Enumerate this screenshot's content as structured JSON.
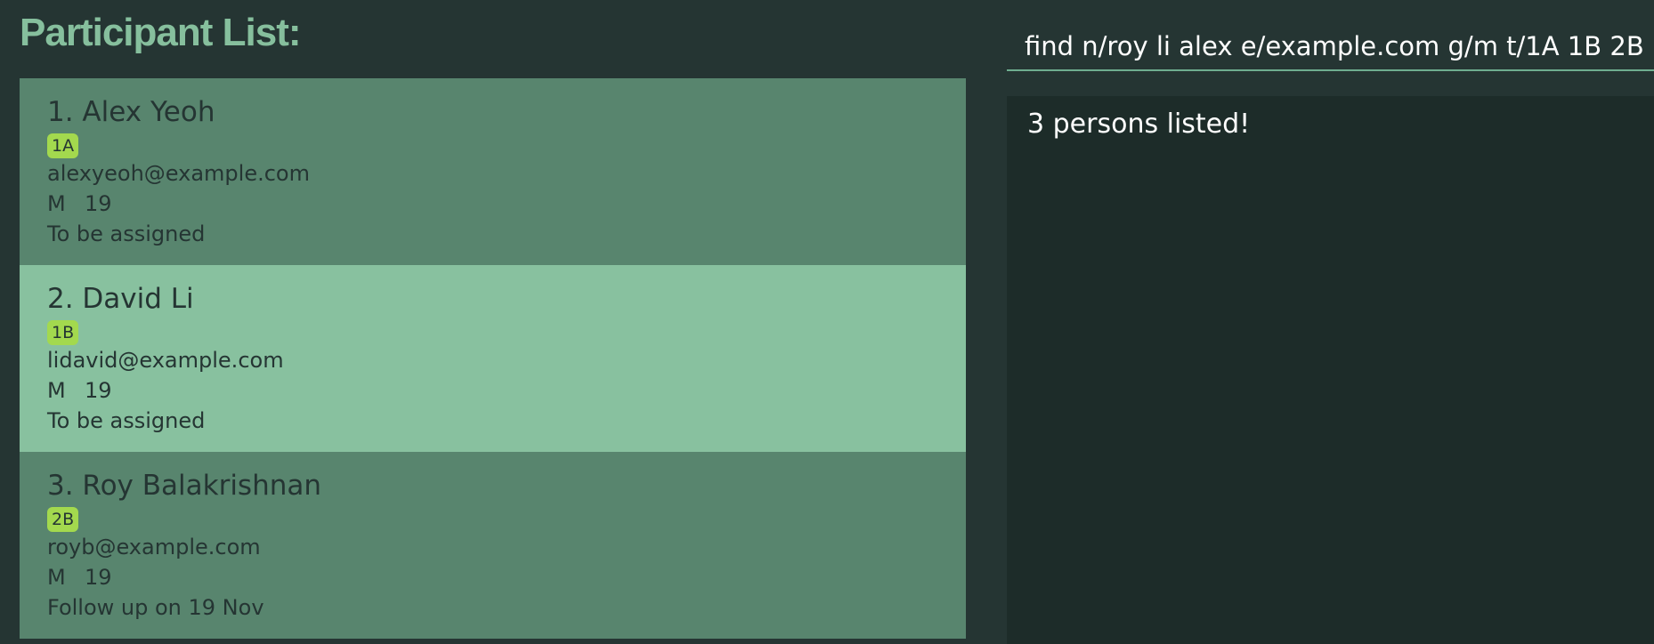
{
  "app": {
    "list_title": "Participant List:"
  },
  "participants": [
    {
      "index_name": "1. Alex Yeoh",
      "tag": "1A",
      "email": "alexyeoh@example.com",
      "gender": "M",
      "age": "19",
      "note": "To be assigned"
    },
    {
      "index_name": "2. David Li",
      "tag": "1B",
      "email": "lidavid@example.com",
      "gender": "M",
      "age": "19",
      "note": "To be assigned"
    },
    {
      "index_name": "3. Roy Balakrishnan",
      "tag": "2B",
      "email": "royb@example.com",
      "gender": "M",
      "age": "19",
      "note": "Follow up on 19 Nov"
    }
  ],
  "command": {
    "value": "find n/roy li alex e/example.com g/m t/1A 1B 2B"
  },
  "result": {
    "message": "3 persons listed!"
  },
  "colors": {
    "background": "#253533",
    "card": "#58856e",
    "card_selected": "#88c19f",
    "tag": "#a3d94e",
    "title": "#86bf9d",
    "result_bg": "#1d2c29"
  }
}
